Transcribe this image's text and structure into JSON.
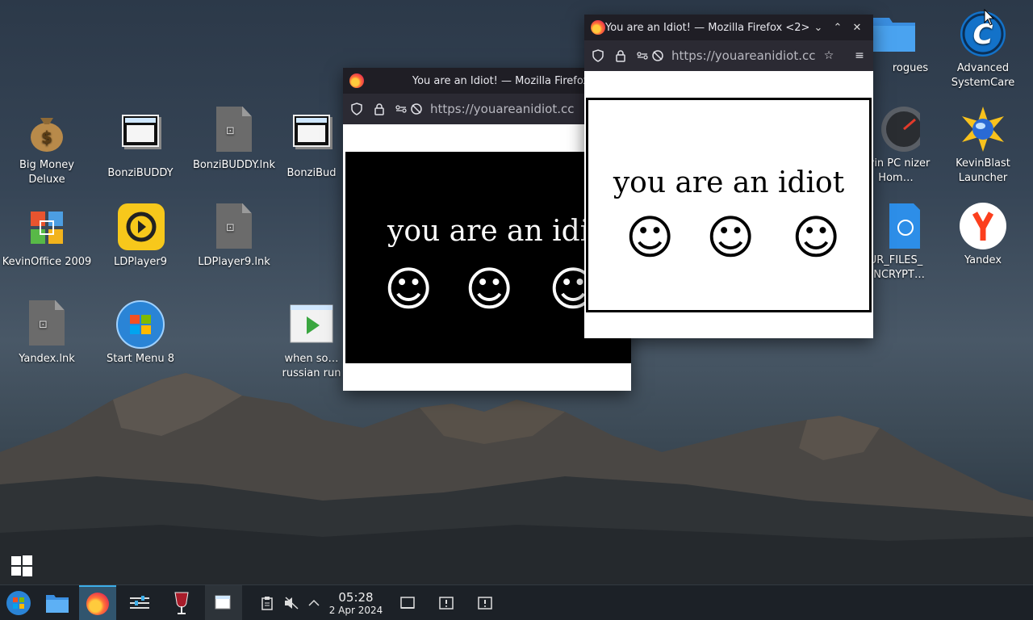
{
  "desktop": {
    "icons": [
      {
        "label": "Big Money Deluxe"
      },
      {
        "label": "BonziBUDDY"
      },
      {
        "label": "BonziBUDDY.lnk"
      },
      {
        "label": "BonziBud"
      },
      {
        "label": "KevinOffice 2009"
      },
      {
        "label": "LDPlayer9"
      },
      {
        "label": "LDPlayer9.lnk"
      },
      {
        "label": "Yandex.lnk"
      },
      {
        "label": "Start Menu 8"
      },
      {
        "label": "when so… russian run"
      },
      {
        "label": "rogues"
      },
      {
        "label": "Advanced SystemCare"
      },
      {
        "label": "evin PC nizer Hom…"
      },
      {
        "label": "KevinBlast Launcher"
      },
      {
        "label": "UR_FILES_ ENCRYPT…"
      },
      {
        "label": "Yandex"
      }
    ]
  },
  "windows": {
    "back": {
      "title": "You are an Idiot! — Mozilla Firefox",
      "url": "https://youareanidiot.cc",
      "text": "you are an idiot",
      "smiley": "☺"
    },
    "front": {
      "title": "You are an Idiot! — Mozilla Firefox <2>",
      "url": "https://youareanidiot.cc",
      "text": "you are an idiot",
      "smiley": "☺"
    }
  },
  "taskbar": {
    "clock_time": "05:28",
    "clock_date": "2 Apr 2024"
  },
  "colors": {
    "taskbar": "#1c2127",
    "active_task": "#31556e",
    "firefox_titlebar": "#1f1e25",
    "firefox_toolbar": "#2b2a33"
  }
}
